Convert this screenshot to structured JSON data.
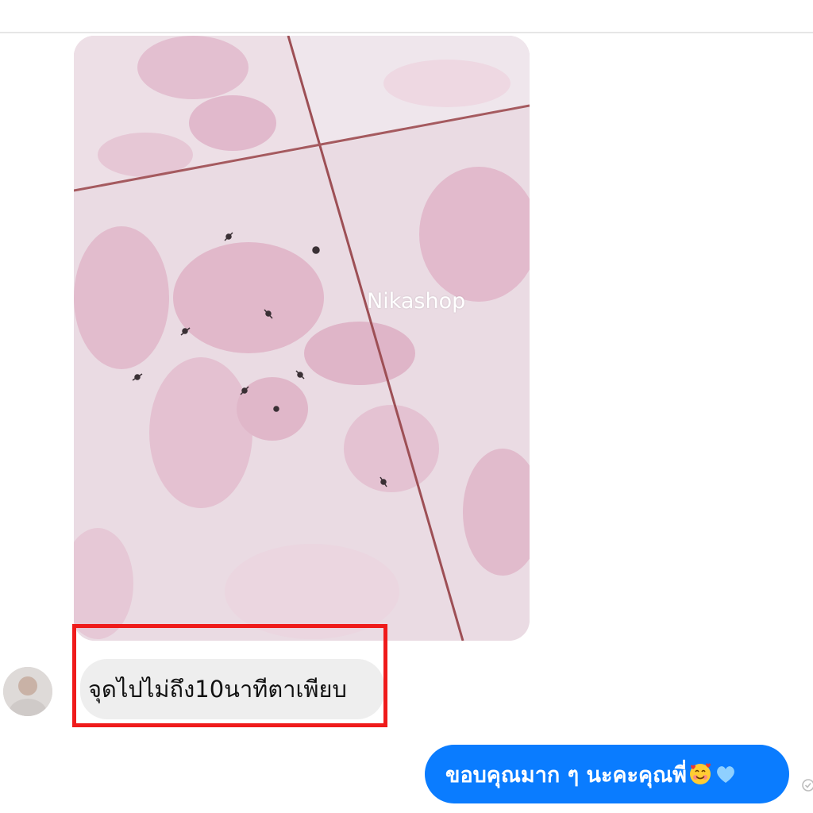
{
  "conversation": {
    "photo_message": {
      "watermark": "Nikashop"
    },
    "incoming_message": {
      "text": "จุดไปไม่ถึง10นาทีตาเพียบ",
      "highlight_color": "#ef1b1b",
      "bubble_color": "#eeeeee"
    },
    "outgoing_message": {
      "text": "ขอบคุณมาก ๆ นะคะคุณพี่",
      "emojis": [
        "smiling-face-with-hearts-icon",
        "light-blue-heart-icon"
      ],
      "bubble_color": "#0a7cff"
    },
    "seen_status": "seen-check-icon"
  }
}
